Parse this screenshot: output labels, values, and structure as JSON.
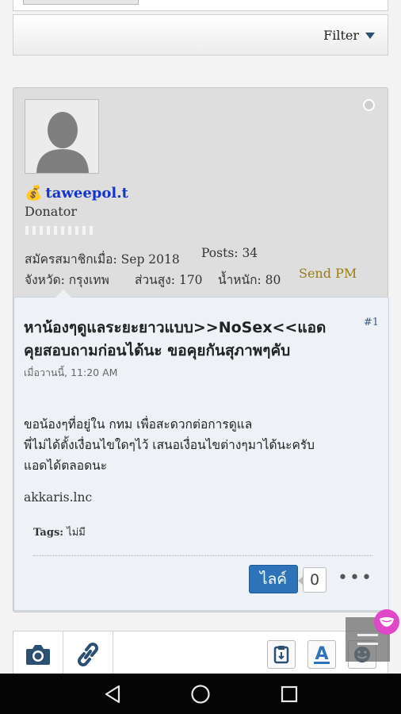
{
  "filter": {
    "label": "Filter"
  },
  "post": {
    "username": "taweepol.t",
    "user_title": "Donator",
    "joined_label": "สมัครสมาชิกเมื่อ:",
    "joined_value": "Sep 2018",
    "posts_label": "Posts:",
    "posts_value": "34",
    "province_label": "จังหวัด:",
    "province_value": "กรุงเทพ",
    "height_label": "ส่วนสูง:",
    "height_value": "170",
    "weight_label": "น้ำหนัก:",
    "weight_value": "80",
    "send_pm": "Send PM",
    "number": "#1",
    "title_line1": "หาน้องๆดูแลระยะยาวแบบ>>NoSex<<แอด",
    "title_line2": "คุยสอบถามก่อนได้นะ ขอคุยกันสุภาพๆคับ",
    "date": "เมื่อวานนี้, 11:20 AM",
    "body_line1": "ขอน้องๆที่อยู่ใน กทม เพื่อสะดวกต่อการดูแล",
    "body_line2": "พี่ไม่ได้ตั้งเงื่อนไขใดๆไว้ เสนอเงื่อนไขต่างๆมาได้นะครับ",
    "body_line3": "แอดได้ตลอดนะ",
    "signature": "akkaris.lnc",
    "tags_label": "Tags:",
    "tags_value": "ไม่มี",
    "like_label": "ไลค์",
    "like_count": "0",
    "more": "•••"
  },
  "icons": {
    "money": "money-bag-icon",
    "online": "online-status-icon",
    "camera": "camera-icon",
    "link": "link-icon",
    "clipboard": "clipboard-icon",
    "text_format": "text-format-icon",
    "smiley": "smiley-icon"
  },
  "colors": {
    "username": "#1536c4",
    "send_pm": "#9b7a14",
    "like_button": "#2e73b8",
    "post_card_bg": "#dedede",
    "message_bg": "#eef2f6"
  }
}
